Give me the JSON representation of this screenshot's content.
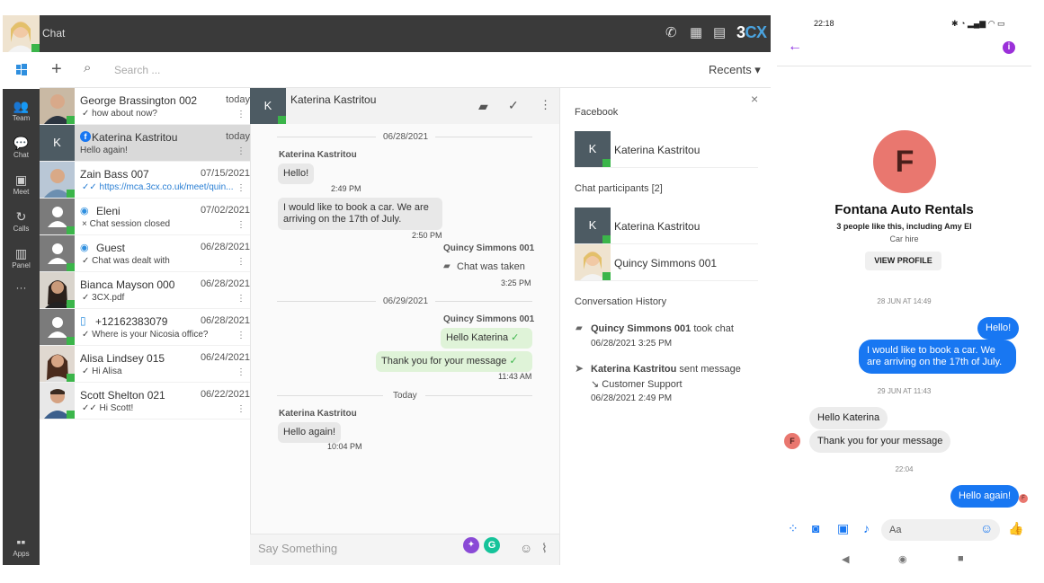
{
  "app": {
    "title": "Chat",
    "brand_a": "3",
    "brand_b": "CX"
  },
  "rail": {
    "items": [
      {
        "label": "Team"
      },
      {
        "label": "Chat"
      },
      {
        "label": "Meet"
      },
      {
        "label": "Calls"
      },
      {
        "label": "Panel"
      },
      {
        "label": "···"
      },
      {
        "label": "Apps"
      }
    ]
  },
  "toolbar": {
    "search_placeholder": "Search ...",
    "recents": "Recents ▾"
  },
  "conversations": [
    {
      "name": "George Brassington 002",
      "date": "today",
      "preview": "✓ how about now?"
    },
    {
      "name": "Katerina Kastritou",
      "date": "today",
      "preview": "Hello again!",
      "initial": "K"
    },
    {
      "name": "Zain Bass 007",
      "date": "07/15/2021",
      "preview": "✓✓ https://mca.3cx.co.uk/meet/quin..."
    },
    {
      "name": "Eleni",
      "date": "07/02/2021",
      "preview": "× Chat session closed"
    },
    {
      "name": "Guest",
      "date": "06/28/2021",
      "preview": "✓ Chat was dealt with"
    },
    {
      "name": "Bianca Mayson 000",
      "date": "06/28/2021",
      "preview": "✓ 3CX.pdf"
    },
    {
      "name": "+12162383079",
      "date": "06/28/2021",
      "preview": "✓ Where is your Nicosia office?"
    },
    {
      "name": "Alisa Lindsey 015",
      "date": "06/24/2021",
      "preview": "✓ Hi Alisa"
    },
    {
      "name": "Scott Shelton 021",
      "date": "06/22/2021",
      "preview": "✓✓ Hi Scott!"
    }
  ],
  "chat": {
    "header_name": "Katerina Kastritou",
    "header_initial": "K",
    "date1": "06/28/2021",
    "date2": "06/29/2021",
    "date3": "Today",
    "m1_sender": "Katerina Kastritou",
    "m1_text": "Hello!",
    "m1_time": "2:49 PM",
    "m2_text": "I would like to book a car. We are arriving on the 17th of July.",
    "m2_time": "2:50 PM",
    "m3_sender": "Quincy Simmons 001",
    "m3_text": "Chat was taken",
    "m3_time": "3:25 PM",
    "m4_sender": "Quincy Simmons 001",
    "m4_text": "Hello Katerina",
    "m5_text": "Thank you for your message",
    "m5_time": "11:43 AM",
    "m6_sender": "Katerina Kastritou",
    "m6_text": "Hello again!",
    "m6_time": "10:04 PM",
    "composer_placeholder": "Say Something"
  },
  "details": {
    "source": "Facebook",
    "contact": "Katerina Kastritou",
    "participants_label": "Chat participants [2]",
    "participant1": "Katerina Kastritou",
    "participant2": "Quincy Simmons 001",
    "history_label": "Conversation History",
    "h1_name": "Quincy Simmons 001",
    "h1_action": " took chat",
    "h1_time": "06/28/2021 3:25 PM",
    "h2_name": "Katerina Kastritou",
    "h2_action": " sent message",
    "h2_sub": "↘ Customer Support",
    "h2_time": "06/28/2021 2:49 PM"
  },
  "phone": {
    "status_time": "22:18",
    "page_initial": "F",
    "page_name": "Fontana Auto Rentals",
    "likes": "3 people like this, including Amy El",
    "category": "Car hire",
    "view_profile": "VIEW PROFILE",
    "d1": "28 JUN AT 14:49",
    "p1": "Hello!",
    "p2": "I would like to book a car. We are arriving on the 17th of July.",
    "d2": "29 JUN AT 11:43",
    "p3": "Hello Katerina",
    "p4": "Thank you for your message",
    "d3": "22:04",
    "p5": "Hello again!",
    "input_placeholder": "Aa"
  },
  "colors": {
    "online": "#3bb54a",
    "messenger_blue": "#1877f2",
    "accent_purple": "#8a2be2"
  }
}
